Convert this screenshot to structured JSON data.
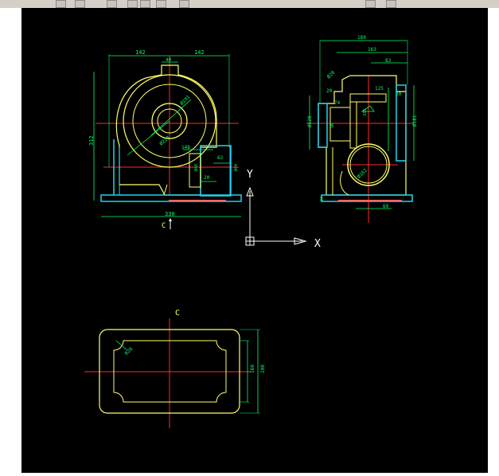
{
  "colors": {
    "background": "#000000",
    "outline": "#ffff66",
    "dimension": "#00ff66",
    "centerline": "#ff2a2a",
    "cyan": "#22d3ee",
    "axis": "#ffffff"
  },
  "ucs": {
    "x_label": "X",
    "y_label": "Y"
  },
  "front_view": {
    "dims": {
      "top_left": "142",
      "top_right": "142",
      "top_center": "40",
      "height": "312",
      "bottom": "330",
      "d1": "Ø191",
      "d2": "Ø228",
      "d3": "148",
      "d4": "62",
      "d5": "Ø48",
      "d6": "Ø44",
      "d7": "20"
    },
    "section_label": "C"
  },
  "side_view": {
    "dims": {
      "top1": "189",
      "top2": "163",
      "top3": "83",
      "left1": "Ø28",
      "r1": "20",
      "r2": "125",
      "r3": "74",
      "r4": "333",
      "left_h": "Ø120",
      "mid": "Ø6",
      "right_h": "Ø181",
      "small": "20",
      "circle": "Ø162",
      "bottom": "69",
      "lower_left": "24"
    }
  },
  "section_view": {
    "title": "C",
    "dims": {
      "radius": "R20",
      "inner": "160",
      "outer": "200"
    }
  }
}
